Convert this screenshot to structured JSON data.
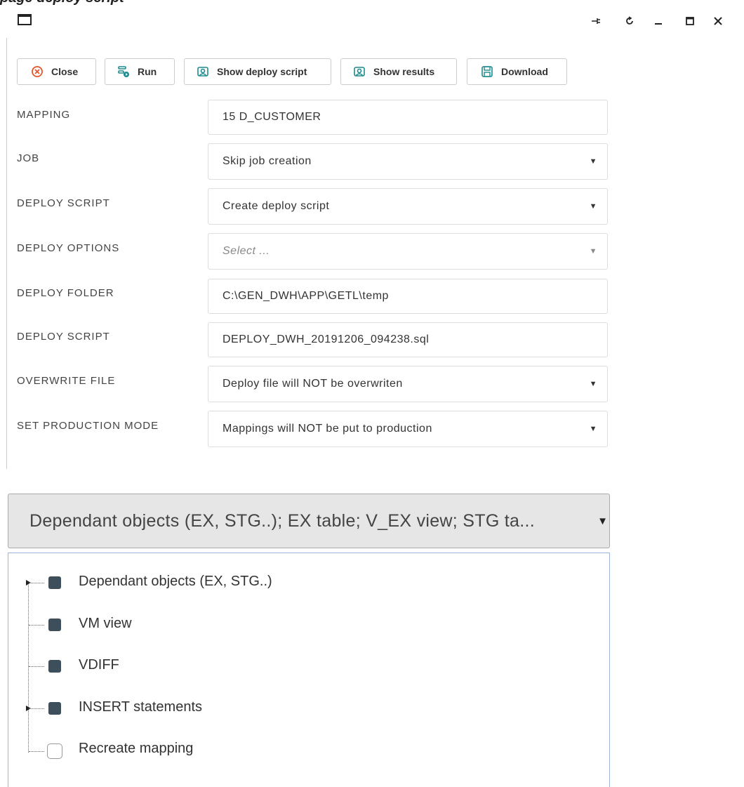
{
  "page_title": "page deploy script",
  "window": {
    "controls": [
      "pin-icon",
      "refresh-icon",
      "minimize-icon",
      "maximize-icon",
      "close-icon"
    ]
  },
  "toolbar": {
    "close_label": "Close",
    "run_label": "Run",
    "show_deploy_label": "Show deploy script",
    "show_results_label": "Show results",
    "download_label": "Download"
  },
  "form": {
    "mapping": {
      "label": "MAPPING",
      "value": "15 D_CUSTOMER"
    },
    "job": {
      "label": "JOB",
      "value": "Skip job creation"
    },
    "deploy_script_select": {
      "label": "DEPLOY SCRIPT",
      "value": "Create deploy script"
    },
    "deploy_options": {
      "label": "DEPLOY OPTIONS",
      "placeholder": "Select ..."
    },
    "deploy_folder": {
      "label": "DEPLOY FOLDER",
      "value": "C:\\GEN_DWH\\APP\\GETL\\temp"
    },
    "deploy_script_file": {
      "label": "DEPLOY SCRIPT",
      "value": "DEPLOY_DWH_20191206_094238.sql"
    },
    "overwrite_file": {
      "label": "OVERWRITE FILE",
      "value": "Deploy file will NOT be overwriten"
    },
    "production_mode": {
      "label": "SET PRODUCTION MODE",
      "value": "Mappings will NOT be put to production"
    }
  },
  "dropdown": {
    "selected_text": "Dependant objects (EX, STG..); EX table; V_EX view; STG ta..."
  },
  "tree": {
    "items": [
      {
        "label": "Dependant objects (EX, STG..)",
        "checked": true,
        "expandable": true
      },
      {
        "label": "VM view",
        "checked": true,
        "expandable": false
      },
      {
        "label": "VDIFF",
        "checked": true,
        "expandable": false
      },
      {
        "label": "INSERT statements",
        "checked": true,
        "expandable": true
      },
      {
        "label": "Recreate mapping",
        "checked": false,
        "expandable": false
      }
    ]
  },
  "colors": {
    "accent_close": "#e2562c",
    "accent_icons": "#1d8b8f",
    "checkbox_fill": "#3d4f5a"
  }
}
